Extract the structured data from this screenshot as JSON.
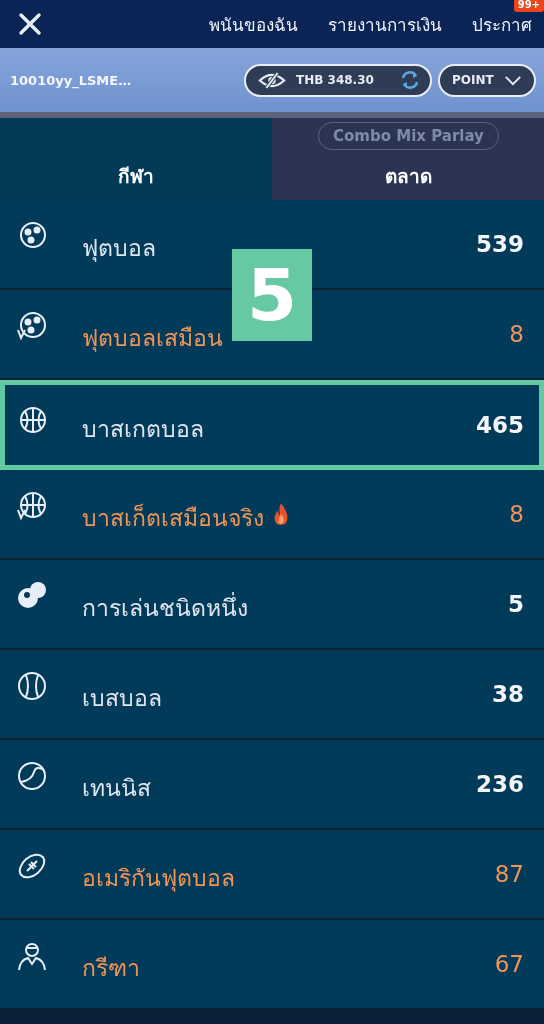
{
  "top_nav": {
    "links": [
      {
        "label": "พนันของฉัน"
      },
      {
        "label": "รายงานการเงิน"
      },
      {
        "label": "ประกาศ",
        "badge": "99+"
      }
    ]
  },
  "account": {
    "username": "10010yy_LSME…",
    "balance": "THB 348.30",
    "point": "POINT"
  },
  "tabs": [
    {
      "label": "กีฬา",
      "selected": true
    },
    {
      "label": "ตลาด",
      "selected": false
    }
  ],
  "behind_overlay": {
    "pill": "Combo Mix Parlay"
  },
  "tutorial_step": "5",
  "sports": [
    {
      "kind": "soccer",
      "name": "ฟุตบอล",
      "count": "539",
      "highlighted": false,
      "hot": false,
      "selected": false
    },
    {
      "kind": "virtual-soccer",
      "name": "ฟุตบอลเสมือน",
      "count": "8",
      "highlighted": true,
      "hot": false,
      "selected": false
    },
    {
      "kind": "basketball",
      "name": "บาสเกตบอล",
      "count": "465",
      "highlighted": false,
      "hot": false,
      "selected": true
    },
    {
      "kind": "virtual-basketball",
      "name": "บาสเก็ตเสมือนจริง",
      "count": "8",
      "highlighted": true,
      "hot": true,
      "selected": false
    },
    {
      "kind": "billiards",
      "name": "การเล่นชนิดหนึ่ง",
      "count": "5",
      "highlighted": false,
      "hot": false,
      "selected": false
    },
    {
      "kind": "baseball",
      "name": "เบสบอล",
      "count": "38",
      "highlighted": false,
      "hot": false,
      "selected": false
    },
    {
      "kind": "tennis",
      "name": "เทนนิส",
      "count": "236",
      "highlighted": false,
      "hot": false,
      "selected": false
    },
    {
      "kind": "american-football",
      "name": "อเมริกันฟุตบอล",
      "count": "87",
      "highlighted": true,
      "hot": false,
      "selected": false
    },
    {
      "kind": "player",
      "name": "กรีฑา",
      "count": "67",
      "highlighted": true,
      "hot": false,
      "selected": false
    }
  ]
}
